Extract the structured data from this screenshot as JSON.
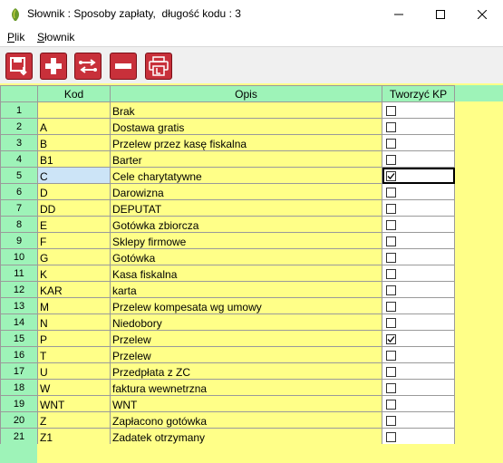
{
  "window": {
    "title": "Słownik : Sposoby zapłaty,  długość kodu : 3"
  },
  "menu": {
    "items": [
      {
        "label": "Plik",
        "key": "P",
        "rest": "lik"
      },
      {
        "label": "Słownik",
        "key": "S",
        "rest": "łownik"
      }
    ]
  },
  "toolbar": {
    "buttons": [
      {
        "name": "save-icon"
      },
      {
        "name": "add-icon"
      },
      {
        "name": "swap-icon"
      },
      {
        "name": "remove-icon"
      },
      {
        "name": "print-icon"
      }
    ]
  },
  "grid": {
    "headers": {
      "kod": "Kod",
      "opis": "Opis",
      "kp": "Tworzyć KP"
    },
    "rows": [
      {
        "n": "1",
        "kod": "",
        "opis": "Brak",
        "kp": false
      },
      {
        "n": "2",
        "kod": "A",
        "opis": "Dostawa gratis",
        "kp": false
      },
      {
        "n": "3",
        "kod": "B",
        "opis": "Przelew przez kasę  fiskalna",
        "kp": false
      },
      {
        "n": "4",
        "kod": "B1",
        "opis": "Barter",
        "kp": false
      },
      {
        "n": "5",
        "kod": "C",
        "opis": "Cele charytatywne",
        "kp": true
      },
      {
        "n": "6",
        "kod": "D",
        "opis": "Darowizna",
        "kp": false
      },
      {
        "n": "7",
        "kod": "DD",
        "opis": "DEPUTAT",
        "kp": false
      },
      {
        "n": "8",
        "kod": "E",
        "opis": "Gotówka zbiorcza",
        "kp": false
      },
      {
        "n": "9",
        "kod": "F",
        "opis": "Sklepy firmowe",
        "kp": false
      },
      {
        "n": "10",
        "kod": "G",
        "opis": "Gotówka",
        "kp": false
      },
      {
        "n": "11",
        "kod": "K",
        "opis": "Kasa fiskalna",
        "kp": false
      },
      {
        "n": "12",
        "kod": "KAR",
        "opis": "karta",
        "kp": false
      },
      {
        "n": "13",
        "kod": "M",
        "opis": "Przelew kompesata wg umowy",
        "kp": false
      },
      {
        "n": "14",
        "kod": "N",
        "opis": "Niedobory",
        "kp": false
      },
      {
        "n": "15",
        "kod": "P",
        "opis": "Przelew",
        "kp": true
      },
      {
        "n": "16",
        "kod": "T",
        "opis": "Przelew",
        "kp": false
      },
      {
        "n": "17",
        "kod": "U",
        "opis": "Przedpłata z ZC",
        "kp": false
      },
      {
        "n": "18",
        "kod": "W",
        "opis": "faktura wewnetrzna",
        "kp": false
      },
      {
        "n": "19",
        "kod": "WNT",
        "opis": "WNT",
        "kp": false
      },
      {
        "n": "20",
        "kod": "Z",
        "opis": "Zapłacono gotówka",
        "kp": false
      },
      {
        "n": "21",
        "kod": "Z1",
        "opis": "Zadatek otrzymany",
        "kp": false
      }
    ]
  },
  "colors": {
    "header_bg": "#9ef3b8",
    "area_bg": "#ffff88",
    "toolbar_button": "#c8303a"
  }
}
